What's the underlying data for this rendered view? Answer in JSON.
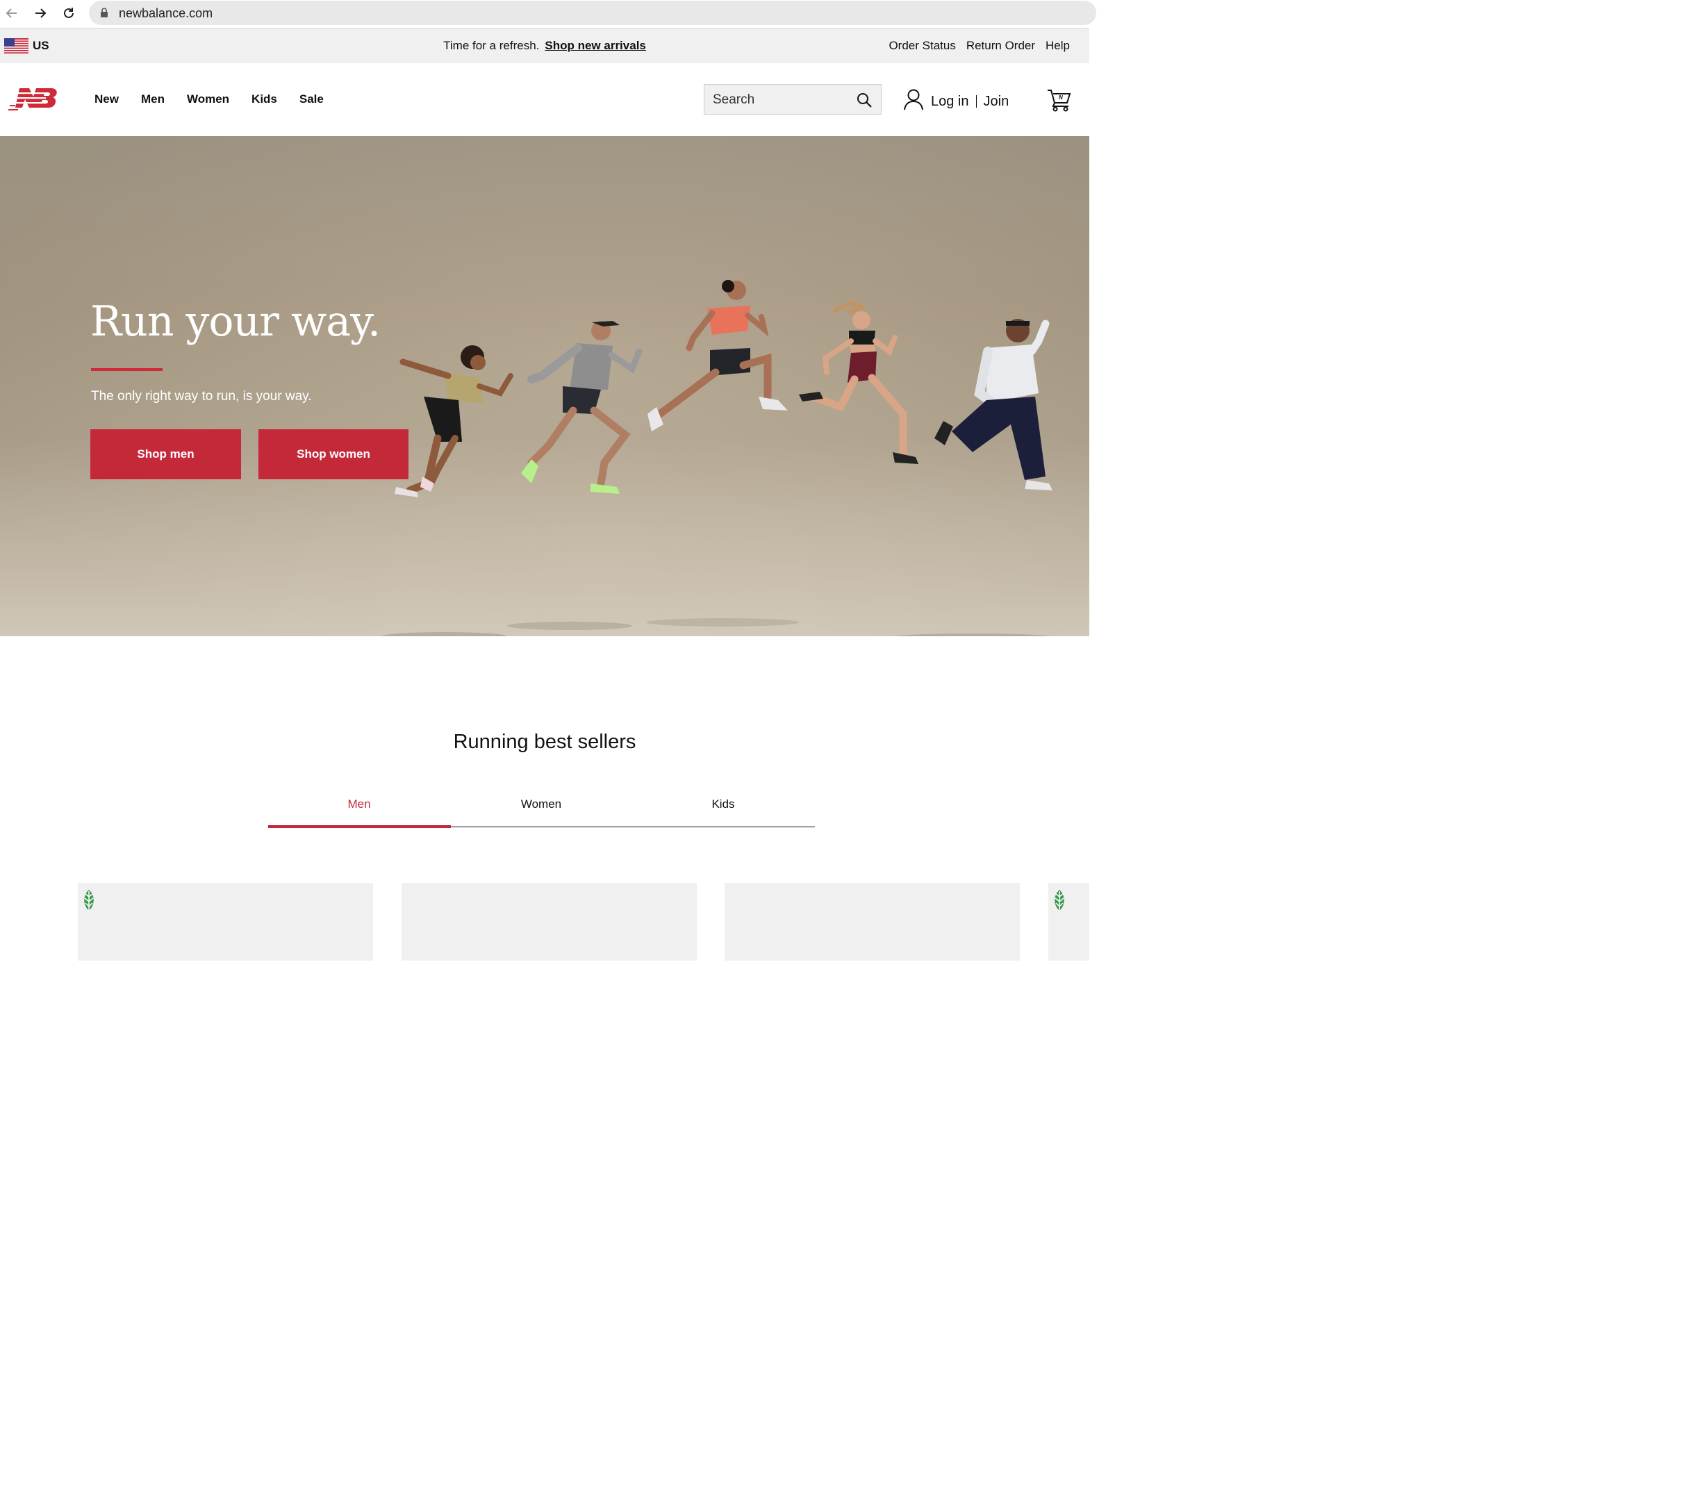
{
  "browser": {
    "url": "newbalance.com"
  },
  "utility_bar": {
    "country": "US",
    "promo_text": "Time for a refresh.",
    "promo_link": "Shop new arrivals",
    "links": [
      "Order Status",
      "Return Order",
      "Help"
    ]
  },
  "header": {
    "nav": [
      "New",
      "Men",
      "Women",
      "Kids",
      "Sale"
    ],
    "search_placeholder": "Search",
    "login": "Log in",
    "join": "Join"
  },
  "hero": {
    "title": "Run your way.",
    "subtitle": "The only right way to run, is your way.",
    "buttons": [
      "Shop men",
      "Shop women"
    ]
  },
  "best_sellers": {
    "title": "Running best sellers",
    "tabs": [
      "Men",
      "Women",
      "Kids"
    ],
    "active_tab": "Men"
  },
  "colors": {
    "brand_red": "#c4293a",
    "leaf_green": "#3a9a4c"
  }
}
